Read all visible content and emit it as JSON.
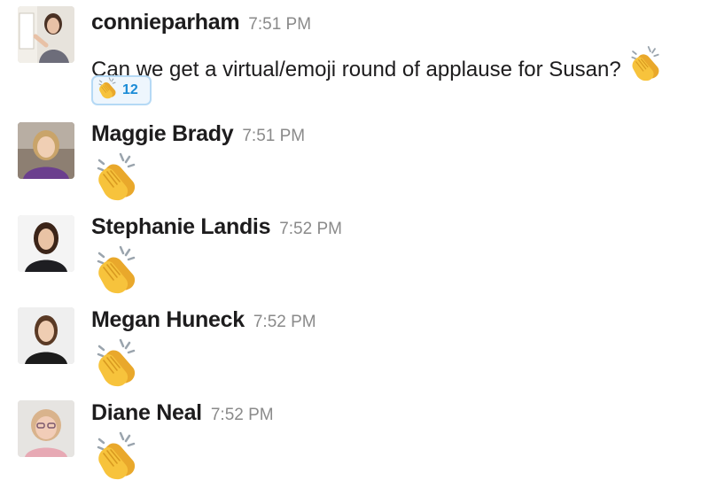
{
  "messages": [
    {
      "username": "connieparham",
      "time": "7:51 PM",
      "text": "Can we get a virtual/emoji round of applause for Susan?",
      "inline_emoji": "clapping-hands",
      "reaction": {
        "emoji": "clapping-hands",
        "count": "12"
      }
    },
    {
      "username": "Maggie Brady",
      "time": "7:51 PM",
      "emoji": "clapping-hands"
    },
    {
      "username": "Stephanie Landis",
      "time": "7:52 PM",
      "emoji": "clapping-hands"
    },
    {
      "username": "Megan Huneck",
      "time": "7:52 PM",
      "emoji": "clapping-hands"
    },
    {
      "username": "Diane Neal",
      "time": "7:52 PM",
      "emoji": "clapping-hands"
    }
  ],
  "colors": {
    "reaction_border": "#b5d9f5",
    "reaction_bg": "#eef6fd",
    "reaction_count": "#1a8bd6",
    "clap_yellow": "#f7c33c"
  }
}
